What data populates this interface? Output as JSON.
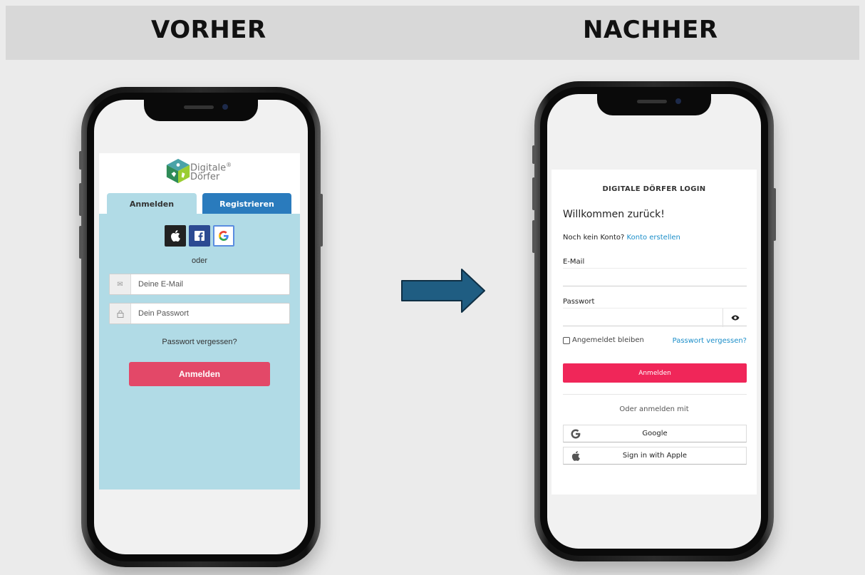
{
  "headings": {
    "before": "VORHER",
    "after": "NACHHER"
  },
  "before_app": {
    "logo_text_line1": "Digitale",
    "logo_text_line2": "Dörfer",
    "logo_mark": "®",
    "tabs": [
      {
        "label": "Anmelden",
        "active": true
      },
      {
        "label": "Registrieren",
        "active": false
      }
    ],
    "social_icons": [
      "apple-icon",
      "facebook-icon",
      "google-icon"
    ],
    "or_text": "oder",
    "email_placeholder": "Deine E-Mail",
    "password_placeholder": "Dein Passwort",
    "forgot_password": "Passwort vergessen?",
    "submit_label": "Anmelden",
    "colors": {
      "panel": "#b1dbe6",
      "tab_inactive": "#2a7bbd",
      "submit": "#e34868"
    }
  },
  "after_app": {
    "title": "DIGITALE DÖRFER LOGIN",
    "welcome": "Willkommen zurück!",
    "no_account_text": "Noch kein Konto?",
    "create_account_link": "Konto erstellen",
    "email_label": "E-Mail",
    "email_value": "",
    "password_label": "Passwort",
    "password_value": "",
    "remember_me": "Angemeldet bleiben",
    "remember_me_checked": false,
    "forgot_password": "Passwort vergessen?",
    "submit_label": "Anmelden",
    "or_sign_in_with": "Oder anmelden mit",
    "providers": [
      {
        "label": "Google",
        "icon": "google-icon"
      },
      {
        "label": "Sign in with Apple",
        "icon": "apple-icon"
      }
    ],
    "colors": {
      "link": "#1b8ec9",
      "submit": "#f02659"
    }
  },
  "arrow_color": "#1f5d82"
}
